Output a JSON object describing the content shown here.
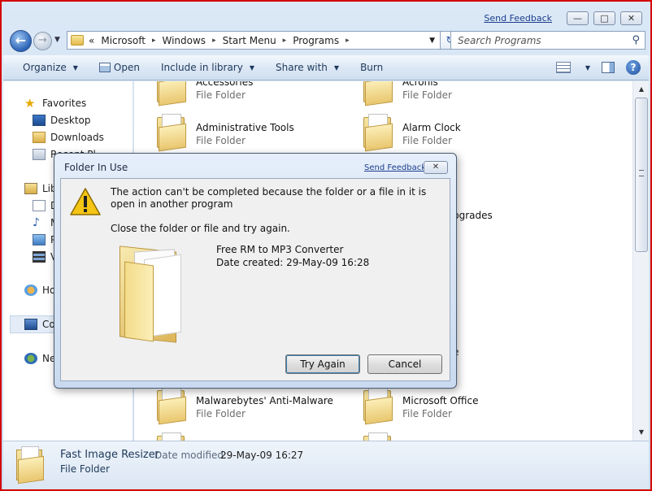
{
  "window": {
    "send_feedback": "Send Feedback",
    "minimize_glyph": "—",
    "maximize_glyph": "□",
    "close_glyph": "✕"
  },
  "address": {
    "overflow": "«",
    "crumbs": [
      "Microsoft",
      "Windows",
      "Start Menu",
      "Programs"
    ],
    "separator": "▸"
  },
  "search": {
    "placeholder": "Search Programs"
  },
  "toolbar": {
    "organize": "Organize",
    "open": "Open",
    "include_in_library": "Include in library",
    "share_with": "Share with",
    "burn": "Burn"
  },
  "nav": {
    "favorites": "Favorites",
    "desktop": "Desktop",
    "downloads": "Downloads",
    "recent": "Recent Pl",
    "libraries": "Libr",
    "lib_docs": "D",
    "lib_music": "M",
    "lib_pictures": "P",
    "lib_videos": "V",
    "homegroup": "Ho",
    "computer": "Co",
    "network": "Ne"
  },
  "files": [
    {
      "name": "Accessories",
      "type": "File Folder"
    },
    {
      "name": "Acronis",
      "type": "File Folder"
    },
    {
      "name": "Administrative Tools",
      "type": "File Folder"
    },
    {
      "name": "Alarm Clock",
      "type": "File Folder"
    },
    {
      "name": "pgrades",
      "type": ""
    },
    {
      "name": "e",
      "type": ""
    },
    {
      "name": "Malwarebytes' Anti-Malware",
      "type": "File Folder"
    },
    {
      "name": "Microsoft Office",
      "type": "File Folder"
    }
  ],
  "details": {
    "name": "Fast Image Resizer",
    "modified_label": "Date modified:",
    "modified_value": "29-May-09 16:27",
    "type": "File Folder"
  },
  "dialog": {
    "title": "Folder In Use",
    "send_feedback": "Send Feedback",
    "message": "The action can't be completed because the folder or a file in it is open in another program",
    "instruction": "Close the folder or file and try again.",
    "item_name": "Free RM to MP3 Converter",
    "item_date": "Date created: 29-May-09 16:28",
    "try_again": "Try Again",
    "cancel": "Cancel",
    "close_glyph": "✕"
  }
}
